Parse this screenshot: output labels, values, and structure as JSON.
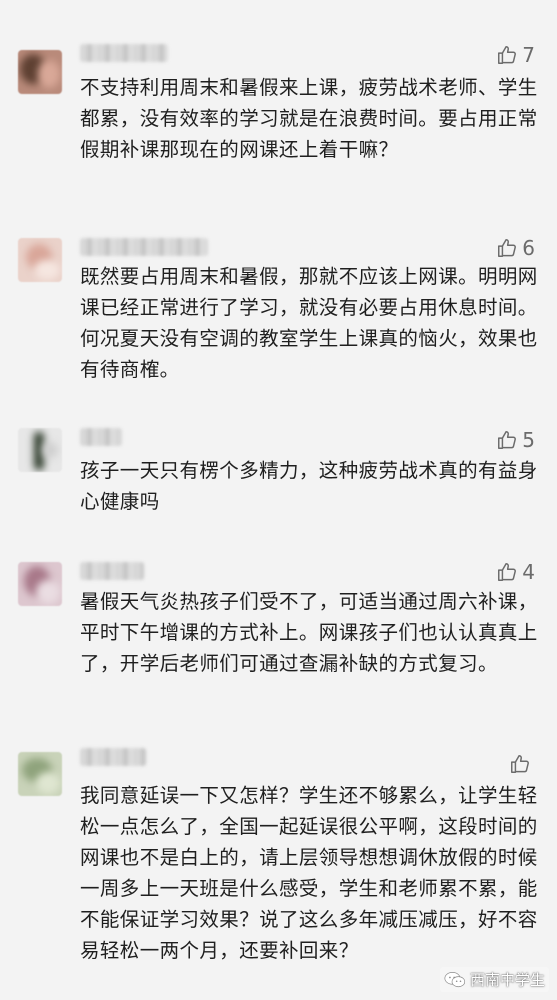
{
  "comments": [
    {
      "likes": "7",
      "text": "不支持利用周末和暑假来上课，疲劳战术老师、学生都累，没有效率的学习就是在浪费时间。要占用正常假期补课那现在的网课还上着干嘛？",
      "avatar_colors": [
        "#7a5a44",
        "#c7897a"
      ]
    },
    {
      "likes": "6",
      "text": "既然要占用周末和暑假，那就不应该上网课。明明网课已经正常进行了学习，就没有必要占用休息时间。何况夏天没有空调的教室学生上课真的恼火，效果也有待商榷。",
      "avatar_colors": [
        "#e4bdb2",
        "#f0d8d0"
      ]
    },
    {
      "likes": "5",
      "text": "孩子一天只有楞个多精力，这种疲劳战术真的有益身心健康吗",
      "avatar_colors": [
        "#2d3b2a",
        "#d8d8d8"
      ]
    },
    {
      "likes": "4",
      "text": "暑假天气炎热孩子们受不了，可适当通过周六补课，平时下午增课的方式补上。网课孩子们也认认真真上了，开学后老师们可通过查漏补缺的方式复习。",
      "avatar_colors": [
        "#b88a98",
        "#e2cdd5"
      ]
    },
    {
      "likes": "",
      "text": "我同意延误一下又怎样？学生还不够累么，让学生轻松一点怎么了，全国一起延误很公平啊，这段时间的网课也不是白上的，请上层领导想想调休放假的时候一周多上一天班是什么感受，学生和老师累不累，能不能保证学习效果？说了这么多年减压减压，好不容易轻松一两个月，还要补回来？",
      "avatar_colors": [
        "#9db08a",
        "#d7dfc7"
      ]
    }
  ],
  "watermark": {
    "text": "西南中学生",
    "icon": "wechat-icon"
  }
}
